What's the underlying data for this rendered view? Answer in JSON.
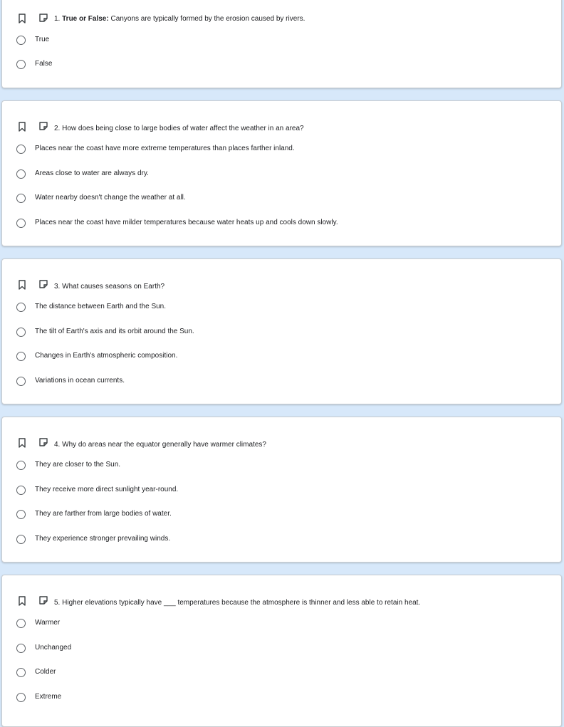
{
  "questions": [
    {
      "number_prefix": "1.",
      "bold_prefix": "True or False:",
      "text": "Canyons are typically formed by the erosion caused by rivers.",
      "options": [
        "True",
        "False"
      ]
    },
    {
      "number_prefix": "2.",
      "bold_prefix": "",
      "text": "How does being close to large bodies of water affect the weather in an area?",
      "options": [
        "Places near the coast have more extreme temperatures than places farther inland.",
        "Areas close to water are always dry.",
        "Water nearby doesn't change the weather at all.",
        "Places near the coast have milder temperatures because water heats up and cools down slowly."
      ]
    },
    {
      "number_prefix": "3.",
      "bold_prefix": "",
      "text": "What causes seasons on Earth?",
      "options": [
        "The distance between Earth and the Sun.",
        "The tilt of Earth's axis and its orbit around the Sun.",
        "Changes in Earth's atmospheric composition.",
        "Variations in ocean currents."
      ]
    },
    {
      "number_prefix": "4.",
      "bold_prefix": "",
      "text": "Why do areas near the equator generally have warmer climates?",
      "options": [
        "They are closer to the Sun.",
        "They receive more direct sunlight year-round.",
        "They are farther from large bodies of water.",
        "They experience stronger prevailing winds."
      ]
    },
    {
      "number_prefix": "5.",
      "bold_prefix": "",
      "text": "Higher elevations typically have ___ temperatures because the atmosphere is thinner and less able to retain heat.",
      "options": [
        "Warmer",
        "Unchanged",
        "Colder",
        "Extreme"
      ]
    }
  ],
  "icons": {
    "bookmark": "bookmark-icon",
    "note": "note-icon"
  },
  "colors": {
    "page_background": "#d7e8fa",
    "card_background": "#ffffff",
    "radio_border": "#5f6368",
    "text": "#202124"
  }
}
